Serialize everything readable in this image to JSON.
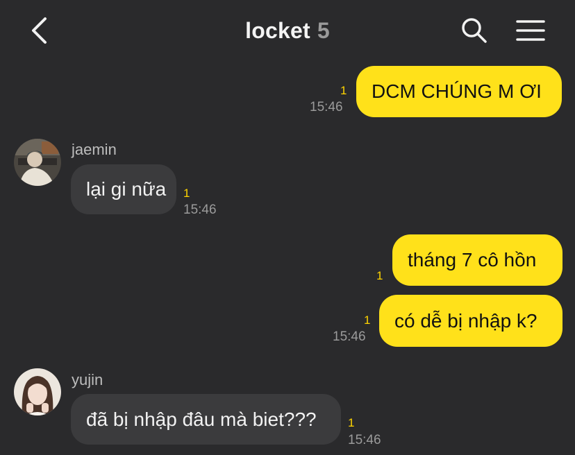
{
  "header": {
    "title": "locket",
    "member_count": "5",
    "back_icon": "chevron-left-icon",
    "search_icon": "search-icon",
    "menu_icon": "hamburger-menu-icon"
  },
  "colors": {
    "background": "#2a2a2c",
    "my_bubble": "#ffe11a",
    "their_bubble": "#3b3b3d",
    "read_count": "#ffd400"
  },
  "messages": [
    {
      "sender": "me",
      "text": "DCM CHÚNG M ƠI",
      "read_count": "1",
      "time": "15:46"
    },
    {
      "sender": "jaemin",
      "text": "lại gi nữa",
      "read_count": "1",
      "time": "15:46"
    },
    {
      "sender": "me",
      "text": "tháng 7 cô hồn",
      "read_count": "1",
      "time": ""
    },
    {
      "sender": "me",
      "text": "có dễ bị nhập k?",
      "read_count": "1",
      "time": "15:46"
    },
    {
      "sender": "yujin",
      "text": "đã bị nhập đâu mà biet???",
      "read_count": "1",
      "time": "15:46"
    }
  ]
}
